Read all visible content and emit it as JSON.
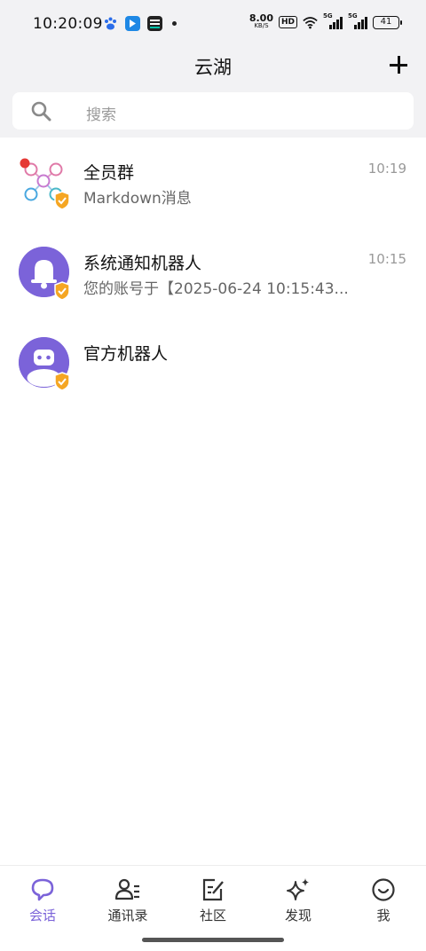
{
  "status_bar": {
    "time": "10:20:09",
    "net_speed_value": "8.00",
    "net_speed_unit": "KB/S",
    "hd_label": "HD",
    "signal_1_label": "5G",
    "signal_2_label": "5G",
    "battery_level": "41",
    "left_icons": [
      "paw-icon",
      "bluetooth-app-icon",
      "news-app-icon",
      "dot-icon"
    ],
    "right_icons": [
      "wifi-icon",
      "signal-icon",
      "signal-icon",
      "battery-icon"
    ]
  },
  "header": {
    "title": "云湖",
    "add_icon": "plus-icon"
  },
  "search": {
    "placeholder": "搜索",
    "icon": "search-icon"
  },
  "conversations": [
    {
      "title": "全员群",
      "subtitle": "Markdown消息",
      "time": "10:19",
      "avatar": "group-avatar",
      "verified": true,
      "unread": true
    },
    {
      "title": "系统通知机器人",
      "subtitle": "您的账号于【2025-06-24 10:15:43...",
      "time": "10:15",
      "avatar": "bell-avatar",
      "verified": true,
      "unread": false
    },
    {
      "title": "官方机器人",
      "subtitle": "",
      "time": "",
      "avatar": "robot-avatar",
      "verified": true,
      "unread": false
    }
  ],
  "tab_bar": {
    "tabs": [
      {
        "label": "会话",
        "icon": "chat-bubble-icon",
        "active": true
      },
      {
        "label": "通讯录",
        "icon": "contacts-icon",
        "active": false
      },
      {
        "label": "社区",
        "icon": "edit-square-icon",
        "active": false
      },
      {
        "label": "发现",
        "icon": "sparkle-icon",
        "active": false
      },
      {
        "label": "我",
        "icon": "smiley-icon",
        "active": false
      }
    ]
  },
  "colors": {
    "accent": "#7b63d9",
    "top_background": "#f2f2f4",
    "unread_dot": "#e53935",
    "verified_shield": "#f5a623"
  }
}
